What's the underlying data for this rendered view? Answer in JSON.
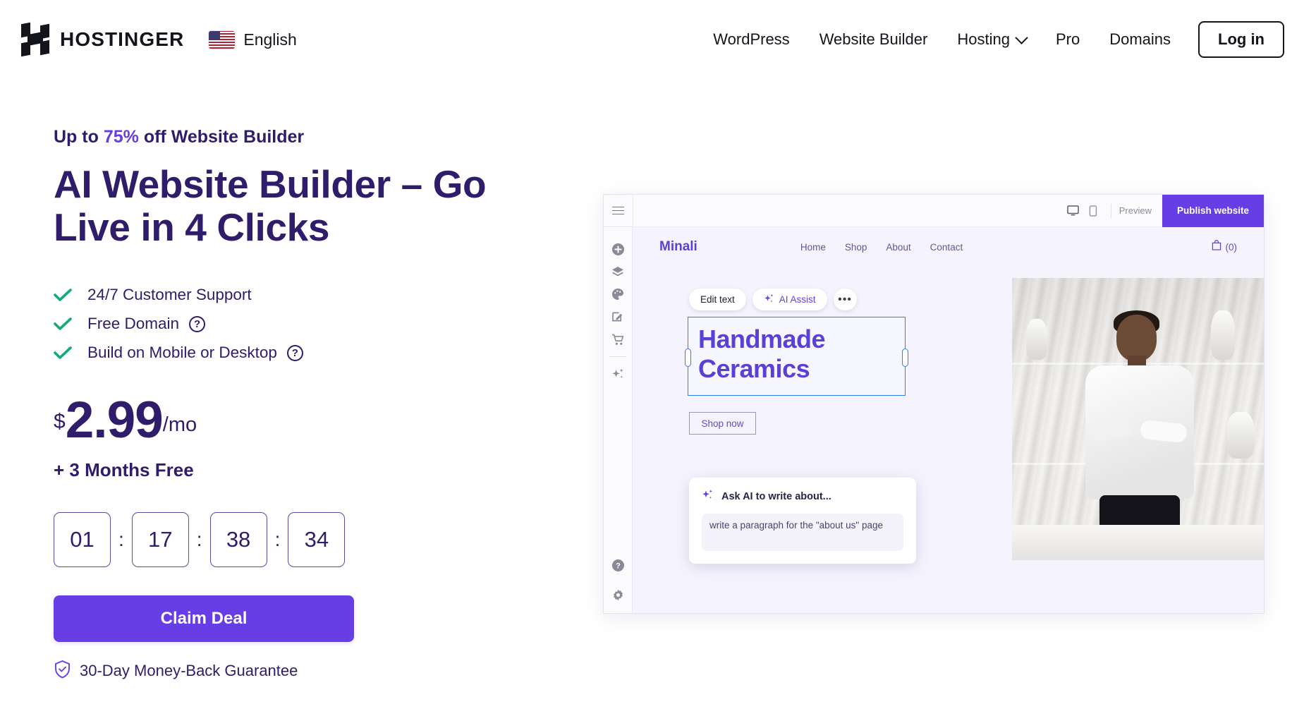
{
  "header": {
    "brand": "HOSTINGER",
    "language": "English",
    "nav": [
      {
        "label": "WordPress",
        "has_dropdown": false
      },
      {
        "label": "Website Builder",
        "has_dropdown": false
      },
      {
        "label": "Hosting",
        "has_dropdown": true
      },
      {
        "label": "Pro",
        "has_dropdown": false
      },
      {
        "label": "Domains",
        "has_dropdown": false
      }
    ],
    "login_label": "Log in"
  },
  "hero": {
    "eyebrow_prefix": "Up to ",
    "eyebrow_percent": "75%",
    "eyebrow_suffix": " off Website Builder",
    "headline": "AI Website Builder – Go Live in 4 Clicks",
    "features": [
      {
        "label": "24/7 Customer Support",
        "help": false
      },
      {
        "label": "Free Domain",
        "help": true
      },
      {
        "label": "Build on Mobile or Desktop",
        "help": true
      }
    ],
    "currency": "$",
    "price": "2.99",
    "period": "/mo",
    "bonus": "+ 3 Months Free",
    "timer": {
      "values": [
        "01",
        "17",
        "38",
        "34"
      ],
      "separator": ":"
    },
    "cta_label": "Claim Deal",
    "guarantee": "30-Day Money-Back Guarantee"
  },
  "builder": {
    "topbar": {
      "preview_label": "Preview",
      "publish_label": "Publish website"
    },
    "sidebar_icons": [
      "plus-icon",
      "layers-icon",
      "palette-icon",
      "edit-icon",
      "cart-icon",
      "sparkles-icon"
    ],
    "sidebar_bottom_icons": [
      "help-icon",
      "settings-icon"
    ],
    "site": {
      "brand": "Minali",
      "nav": [
        "Home",
        "Shop",
        "About",
        "Contact"
      ],
      "cart_count": "(0)"
    },
    "toolbar": {
      "edit_text_label": "Edit text",
      "ai_assist_label": "AI Assist",
      "more_label": "•••"
    },
    "heading": "Handmade Ceramics",
    "shop_button": "Shop now",
    "ai_panel": {
      "title": "Ask AI to write about...",
      "input_value": "write a paragraph for the \"about us\" page"
    }
  },
  "colors": {
    "primary_purple": "#673DE6",
    "deep_purple": "#2F1C6A",
    "check_green": "#13AA7F",
    "selection_blue": "#2D7FF9"
  }
}
